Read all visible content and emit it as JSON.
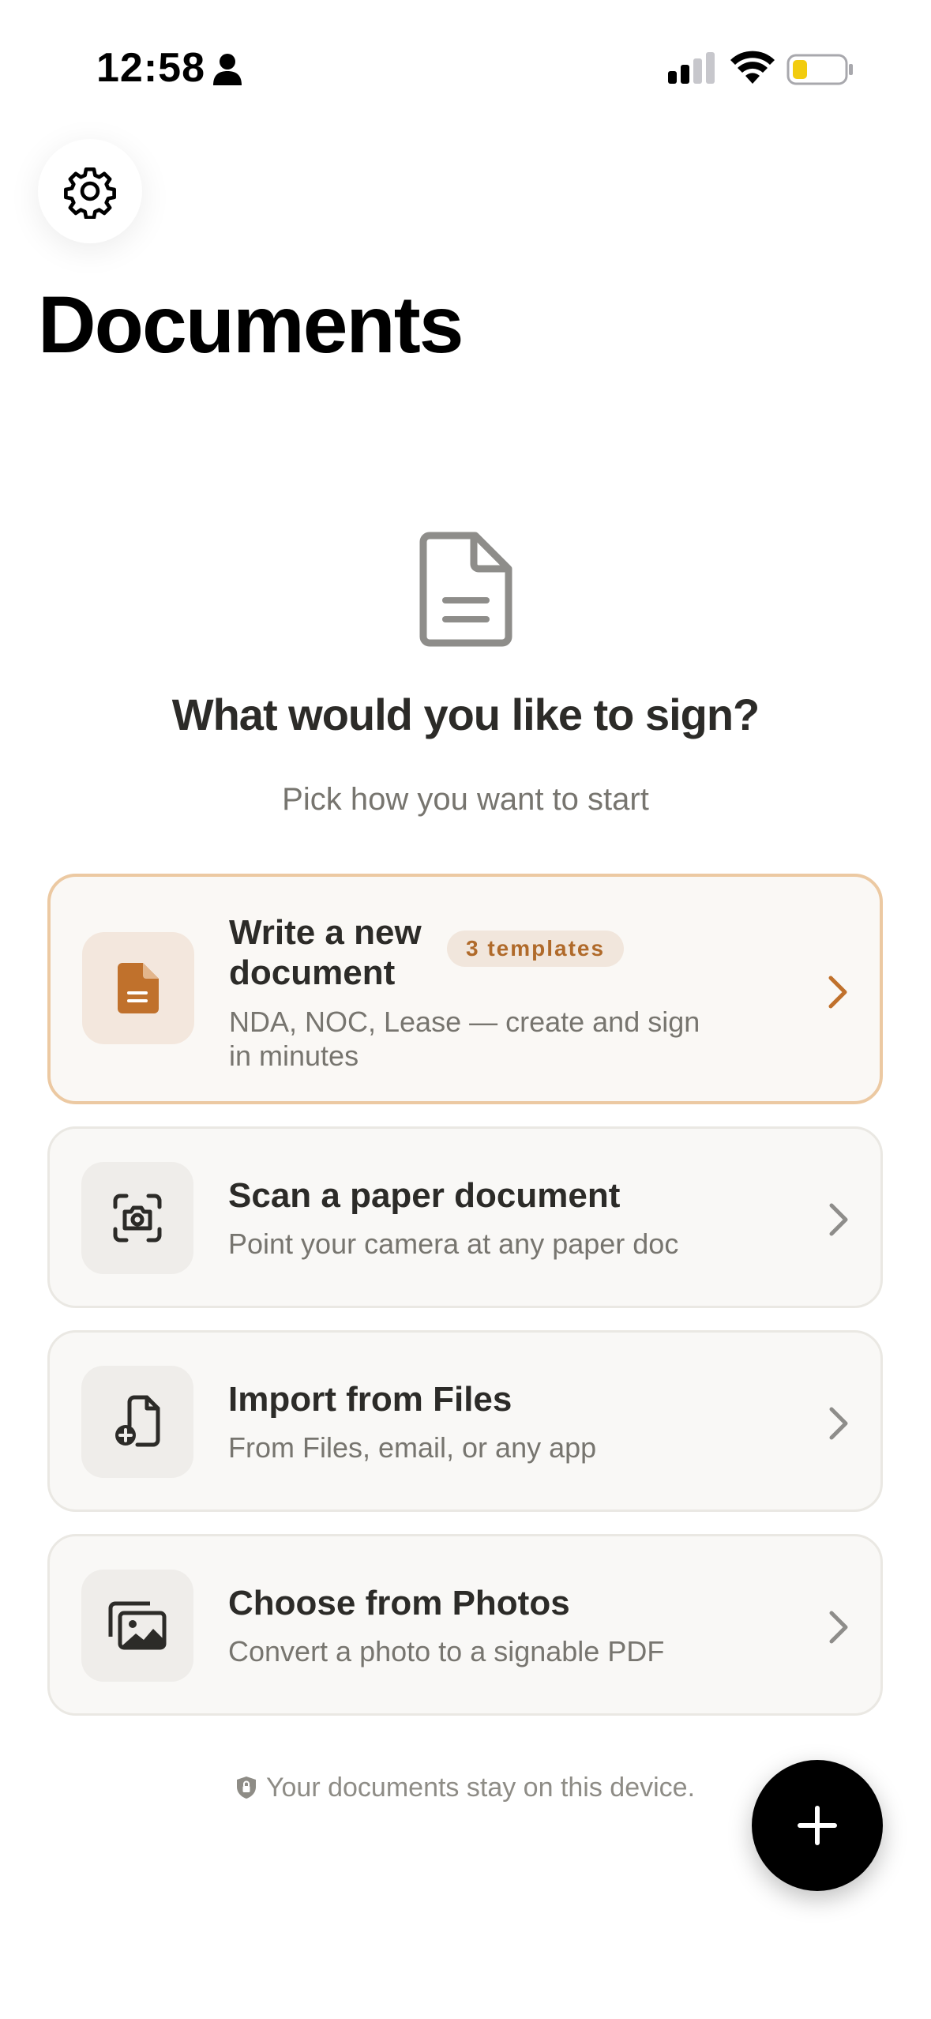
{
  "status_bar": {
    "time": "12:58"
  },
  "header": {
    "title": "Documents"
  },
  "hero": {
    "title": "What would you like to sign?",
    "subtitle": "Pick how you want to start"
  },
  "options": [
    {
      "title_line1": "Write a new",
      "title_line2": "document",
      "badge": "3 templates",
      "desc_line1": "NDA, NOC, Lease — create and sign",
      "desc_line2": "in minutes",
      "icon": "document-icon"
    },
    {
      "title": "Scan a paper document",
      "desc": "Point your camera at any paper doc",
      "icon": "camera-scan-icon"
    },
    {
      "title": "Import from Files",
      "desc": "From Files, email, or any app",
      "icon": "file-add-icon"
    },
    {
      "title": "Choose from Photos",
      "desc": "Convert a photo to a signable PDF",
      "icon": "photos-icon"
    }
  ],
  "footer": {
    "note": "Your documents stay on this device."
  },
  "colors": {
    "accent": "#b06a2a",
    "badge_bg": "#f1e6dc",
    "fab": "#000000"
  }
}
